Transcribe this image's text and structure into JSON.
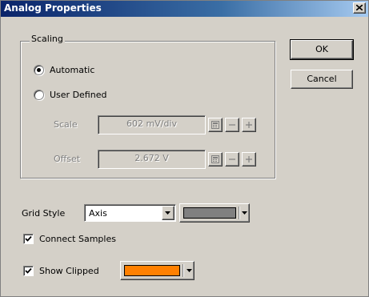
{
  "window": {
    "title": "Analog Properties"
  },
  "scaling": {
    "group_label": "Scaling",
    "automatic_label": "Automatic",
    "user_defined_label": "User Defined",
    "selected": "automatic",
    "scale_label": "Scale",
    "scale_value": "602 mV/div",
    "offset_label": "Offset",
    "offset_value": "2.672 V"
  },
  "buttons": {
    "ok": "OK",
    "cancel": "Cancel"
  },
  "grid_style": {
    "label": "Grid Style",
    "value": "Axis",
    "color": "#808080"
  },
  "connect_samples": {
    "label": "Connect Samples",
    "checked": true
  },
  "show_clipped": {
    "label": "Show Clipped",
    "checked": true,
    "color": "#ff8000"
  }
}
